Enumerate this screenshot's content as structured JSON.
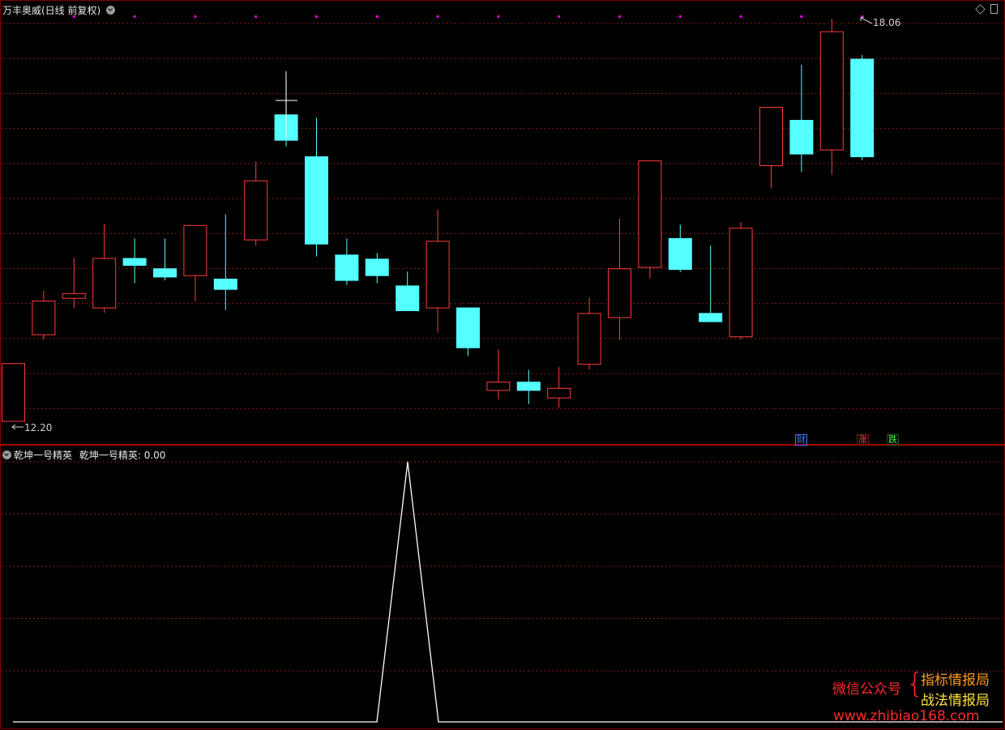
{
  "main_title": "万丰奥威(日线 前复权)",
  "indicator": {
    "name": "乾坤一号精英",
    "label": "乾坤一号精英",
    "value": "0.00"
  },
  "max_label": "18.06",
  "min_label": "12.20",
  "event_tags": [
    {
      "text": "财",
      "color": "#3d7bff"
    },
    {
      "text": "涨",
      "color": "#ff4040"
    },
    {
      "text": "跌",
      "color": "#40ff40"
    }
  ],
  "watermark": {
    "left": "微信公众号",
    "brace": "{",
    "line1": "指标情报局",
    "line2": "战法情报局",
    "url": "www.zhibiao168.com"
  },
  "colors": {
    "up": "#ff3b3b",
    "down": "#54ffff",
    "grid": "#8a1a1a",
    "marker": "#e000e0",
    "line": "#ffffff",
    "panel_border": "#7a0000"
  },
  "chart_data": [
    {
      "type": "candlestick",
      "title": "万丰奥威(日线 前复权)",
      "ylim": [
        12.1,
        18.3
      ],
      "grid": true,
      "annotations": [
        {
          "text": "18.06",
          "at": "max high"
        },
        {
          "text": "12.20",
          "at": "min low"
        }
      ],
      "candles": [
        {
          "o": 12.2,
          "h": 13.04,
          "l": 12.2,
          "c": 13.04
        },
        {
          "o": 13.46,
          "h": 14.1,
          "l": 13.39,
          "c": 13.95
        },
        {
          "o": 13.99,
          "h": 14.58,
          "l": 13.85,
          "c": 14.06
        },
        {
          "o": 13.85,
          "h": 15.07,
          "l": 13.78,
          "c": 14.57
        },
        {
          "o": 14.57,
          "h": 14.86,
          "l": 14.21,
          "c": 14.47
        },
        {
          "o": 14.42,
          "h": 14.86,
          "l": 14.25,
          "c": 14.3
        },
        {
          "o": 14.32,
          "h": 15.03,
          "l": 13.95,
          "c": 15.05
        },
        {
          "o": 14.27,
          "h": 15.21,
          "l": 13.82,
          "c": 14.12
        },
        {
          "o": 14.84,
          "h": 15.98,
          "l": 14.76,
          "c": 15.7
        },
        {
          "o": 16.66,
          "h": 17.17,
          "l": 16.2,
          "c": 16.29
        },
        {
          "o": 16.05,
          "h": 16.62,
          "l": 14.6,
          "c": 14.78
        },
        {
          "o": 14.62,
          "h": 14.86,
          "l": 14.18,
          "c": 14.25
        },
        {
          "o": 14.56,
          "h": 14.65,
          "l": 14.21,
          "c": 14.32
        },
        {
          "o": 14.17,
          "h": 14.38,
          "l": 13.83,
          "c": 13.81
        },
        {
          "o": 13.85,
          "h": 15.28,
          "l": 13.49,
          "c": 14.82
        },
        {
          "o": 13.85,
          "h": 13.85,
          "l": 13.15,
          "c": 13.27
        },
        {
          "o": 12.65,
          "h": 13.25,
          "l": 12.52,
          "c": 12.77
        },
        {
          "o": 12.77,
          "h": 12.95,
          "l": 12.45,
          "c": 12.65
        },
        {
          "o": 12.54,
          "h": 12.99,
          "l": 12.4,
          "c": 12.68
        },
        {
          "o": 13.03,
          "h": 14.0,
          "l": 12.95,
          "c": 13.77
        },
        {
          "o": 13.71,
          "h": 15.15,
          "l": 13.38,
          "c": 14.42
        },
        {
          "o": 14.44,
          "h": 15.99,
          "l": 14.28,
          "c": 15.99
        },
        {
          "o": 14.86,
          "h": 15.06,
          "l": 14.37,
          "c": 14.41
        },
        {
          "o": 13.77,
          "h": 14.76,
          "l": 13.66,
          "c": 13.65
        },
        {
          "o": 13.43,
          "h": 15.1,
          "l": 13.39,
          "c": 15.01
        },
        {
          "o": 15.92,
          "h": 15.92,
          "l": 15.59,
          "c": 16.77
        },
        {
          "o": 16.58,
          "h": 17.39,
          "l": 15.83,
          "c": 16.09
        },
        {
          "o": 16.15,
          "h": 18.06,
          "l": 15.79,
          "c": 17.87
        },
        {
          "o": 17.47,
          "h": 17.53,
          "l": 16.0,
          "c": 16.05
        }
      ]
    },
    {
      "type": "line",
      "title": "乾坤一号精英",
      "ylim": [
        0,
        1.0
      ],
      "grid": true,
      "x_start": 0.3,
      "values": [
        0,
        0,
        0,
        0,
        0,
        0,
        0,
        0,
        0,
        0,
        0,
        0,
        0,
        1,
        0,
        0,
        0,
        0,
        0,
        0,
        0,
        0,
        0,
        0,
        0,
        0,
        0,
        0,
        0,
        0,
        0,
        0
      ]
    }
  ]
}
